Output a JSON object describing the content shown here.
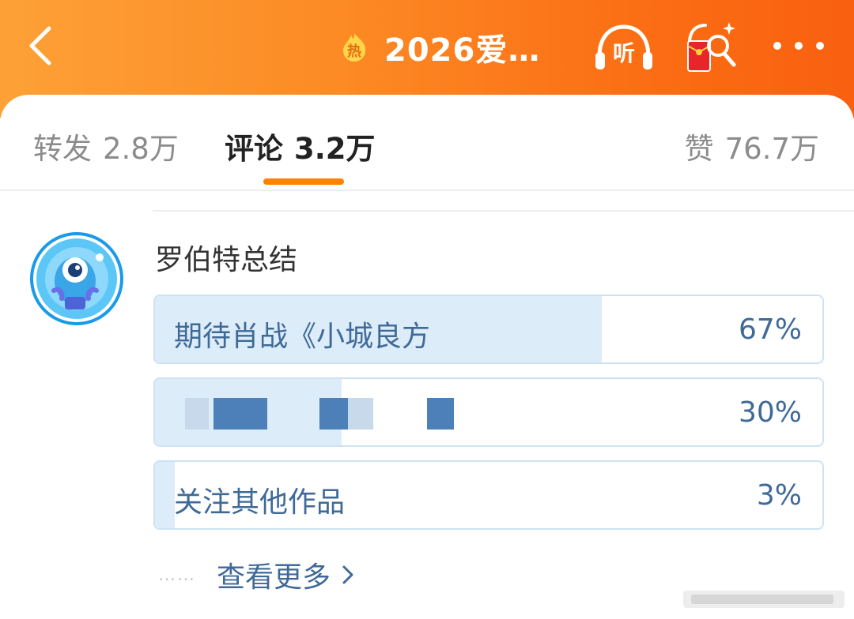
{
  "header": {
    "title": "2026爱…",
    "hot_badge_text": "热",
    "listen_label": "听"
  },
  "tabs": [
    {
      "label": "转发",
      "count": "2.8万"
    },
    {
      "label": "评论",
      "count": "3.2万"
    },
    {
      "label": "赞",
      "count": "76.7万"
    }
  ],
  "comment": {
    "username": "罗伯特总结",
    "poll": {
      "options": [
        {
          "label": "期待肖战《小城良方",
          "percent": "67%",
          "fraction": 0.67
        },
        {
          "label": "",
          "percent": "30%",
          "fraction": 0.28
        },
        {
          "label": "关注其他作品",
          "percent": "3%",
          "fraction": 0.03
        }
      ]
    },
    "dots": "……",
    "view_more": "查看更多"
  },
  "colors": {
    "header_orange": "#fb6e14",
    "accent": "#ff8200",
    "poll_text": "#3f6a97",
    "poll_fill": "#dcecf9"
  },
  "icons": [
    "back-icon",
    "hot-badge-icon",
    "listen-icon",
    "red-packet-icon",
    "more-icon",
    "chevron-right-icon"
  ]
}
